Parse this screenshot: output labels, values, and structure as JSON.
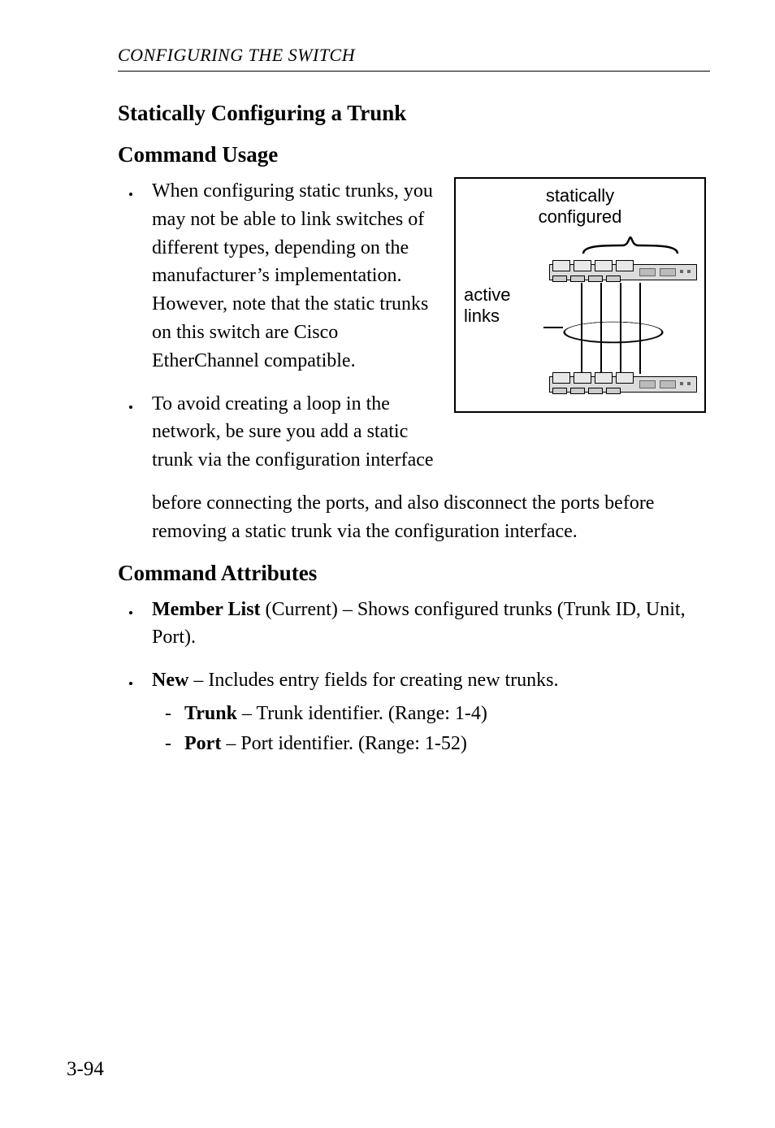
{
  "running_head": "CONFIGURING THE SWITCH",
  "headings": {
    "h2": "Statically Configuring a Trunk",
    "usage": "Command Usage",
    "attributes": "Command Attributes"
  },
  "usage_bullets": {
    "b1": "When configuring static trunks, you may not be able to link switches of different types, depending on the manufacturer’s implementation. However, note that the static trunks on this switch are Cisco EtherChannel compatible.",
    "b2": "To avoid creating a loop in the network, be sure you add a static trunk via the configuration interface"
  },
  "continuation": "before connecting the ports, and also disconnect the ports before removing a static trunk via the configuration interface.",
  "attr_bullets": {
    "member_list_label": "Member List",
    "member_list_suffix": " (Current) – Shows configured trunks (Trunk ID, Unit, Port).",
    "new_label": "New",
    "new_suffix": " – Includes entry fields for creating new trunks.",
    "trunk_label": "Trunk",
    "trunk_suffix": " – Trunk identifier. (Range: 1-4)",
    "port_label": "Port",
    "port_suffix": " – Port identifier. (Range: 1-52)"
  },
  "figure": {
    "statically_configured": "statically\nconfigured",
    "active_links": "active\nlinks"
  },
  "page_number": "3-94"
}
